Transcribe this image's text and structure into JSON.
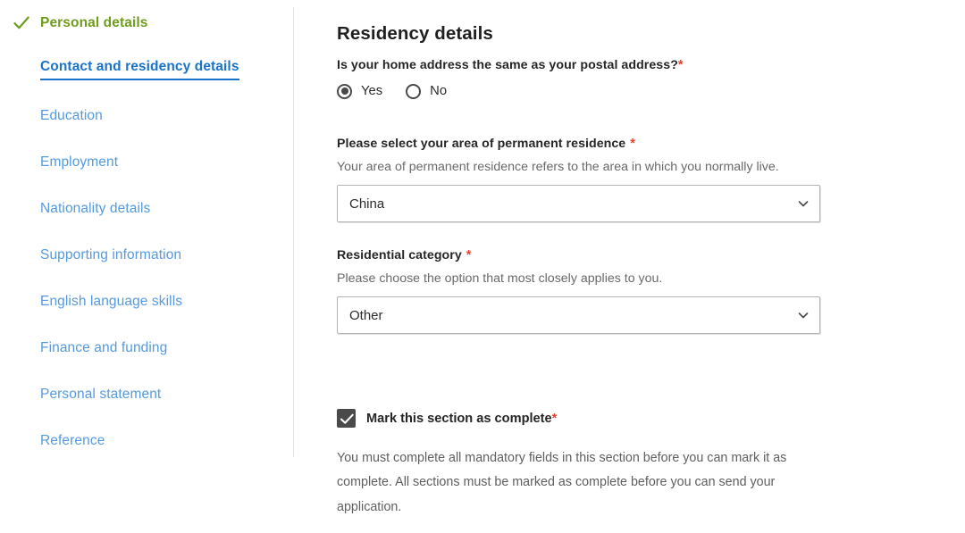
{
  "sidebar": {
    "items": [
      {
        "label": "Personal details",
        "state": "done",
        "icon": "check-icon"
      },
      {
        "label": "Contact and residency details",
        "state": "active",
        "icon": ""
      },
      {
        "label": "Education",
        "state": "link",
        "icon": ""
      },
      {
        "label": "Employment",
        "state": "link",
        "icon": ""
      },
      {
        "label": "Nationality details",
        "state": "link",
        "icon": ""
      },
      {
        "label": "Supporting information",
        "state": "link",
        "icon": ""
      },
      {
        "label": "English language skills",
        "state": "link",
        "icon": ""
      },
      {
        "label": "Finance and funding",
        "state": "link",
        "icon": ""
      },
      {
        "label": "Personal statement",
        "state": "link",
        "icon": ""
      },
      {
        "label": "Reference",
        "state": "link",
        "icon": ""
      }
    ]
  },
  "main": {
    "section_title": "Residency details",
    "required_marker": "*",
    "home_address_question": {
      "label": "Is your home address the same as your postal address?",
      "options": [
        {
          "label": "Yes",
          "selected": true
        },
        {
          "label": "No",
          "selected": false
        }
      ]
    },
    "permanent_residence": {
      "label": "Please select your area of permanent residence",
      "hint": "Your area of permanent residence refers to the area in which you normally live.",
      "value": "China",
      "chevron_icon": "chevron-down-icon"
    },
    "residential_category": {
      "label": "Residential category",
      "hint": "Please choose the option that most closely applies to you.",
      "value": "Other",
      "chevron_icon": "chevron-down-icon"
    },
    "mark_complete": {
      "label": "Mark this section as complete",
      "checked": true,
      "note": "You must complete all mandatory fields in this section before you can mark it as complete. All sections must be marked as complete before you can send your application."
    }
  },
  "colors": {
    "done_green": "#6f9c1c",
    "active_blue": "#1a73c9",
    "link_blue": "#559ae0",
    "required_red": "#e8412c",
    "control_gray": "#4a4a4a",
    "divider": "#e4e4e4"
  }
}
